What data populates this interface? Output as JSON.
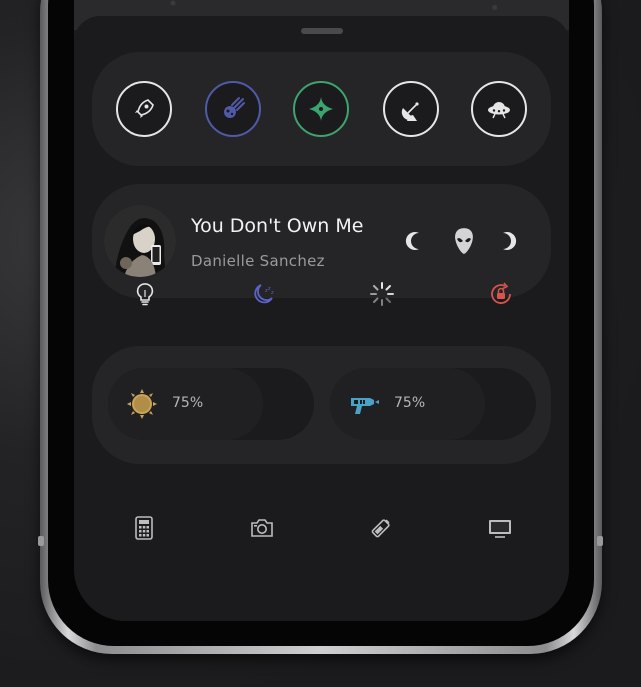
{
  "toolbar": {
    "items": [
      {
        "icon": "rocket-icon",
        "color": "#e6e6e6"
      },
      {
        "icon": "meteor-icon",
        "color": "#4f5aa8"
      },
      {
        "icon": "sparkle-icon",
        "color": "#3da36f"
      },
      {
        "icon": "satellite-dish-icon",
        "color": "#e6e6e6"
      },
      {
        "icon": "ufo-icon",
        "color": "#e6e6e6"
      }
    ]
  },
  "media": {
    "title": "You Don't Own Me",
    "artist": "Danielle Sanchez",
    "controls": [
      "previous-icon",
      "alien-icon",
      "next-icon"
    ]
  },
  "toggles": [
    {
      "icon": "lightbulb-icon",
      "color": "#e6e6e6"
    },
    {
      "icon": "moon-sleep-icon",
      "color": "#5b63c9"
    },
    {
      "icon": "loading-spinner-icon",
      "color": "#e6e6e6"
    },
    {
      "icon": "rotation-lock-icon",
      "color": "#d9534f"
    }
  ],
  "sliders": {
    "brightness": {
      "label": "75%",
      "value": 0.75,
      "icon": "sun-icon",
      "color": "#c9a45a"
    },
    "volume": {
      "label": "75%",
      "value": 0.75,
      "icon": "ray-gun-icon",
      "color": "#4aa3c7"
    }
  },
  "dock": [
    {
      "icon": "calculator-icon"
    },
    {
      "icon": "camera-icon"
    },
    {
      "icon": "battery-icon"
    },
    {
      "icon": "screen-mirror-icon"
    }
  ]
}
